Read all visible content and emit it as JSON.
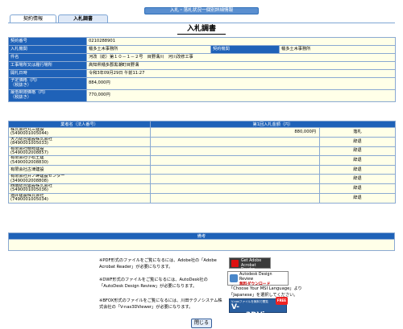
{
  "header": {
    "title": "入札・落札状況一個別詳細情報"
  },
  "tabs": [
    {
      "label": "契約情報"
    },
    {
      "label": "入札調書"
    }
  ],
  "page_title": "入札調書",
  "info": {
    "contract_no_label": "契約番号",
    "contract_no": "0210288901",
    "bid_agency_label": "入札機関",
    "bid_agency": "幡多土木事務所",
    "contract_agency_label": "契約機関",
    "contract_agency": "幡多土木事務所",
    "item_label": "件名",
    "item": "河改（総）第１０－１－２号　目野溝川　河川改修工事",
    "location_label": "工事場所又は履行場所",
    "location": "高知県幡多郡黒潮町目野溝",
    "date_label": "開札日時",
    "date": "令和3年09月29日 午前11:27",
    "planned_label": "予定価格（円）",
    "planned_sub": "（税抜き）",
    "planned": "884,000円",
    "min_label": "最低制限価格（円）",
    "min_sub": "（税抜き）",
    "min": "770,000円"
  },
  "bids": {
    "col_name": "業者名（法人番号）",
    "col_amount": "第1回入札金額（円）",
    "rows": [
      {
        "name": "株式会社丸三建設",
        "corp": "(5490001005044)",
        "amount": "880,000円",
        "result": "落札"
      },
      {
        "name": "大方総合建設株式会社",
        "corp": "(8490001005033)",
        "amount": "",
        "result": "辞退"
      },
      {
        "name": "有限会社穂岐建設",
        "corp": "(5490002008857)",
        "amount": "",
        "result": "辞退"
      },
      {
        "name": "有限会社小松土建",
        "corp": "(5490002008830)",
        "amount": "",
        "result": "辞退"
      },
      {
        "name": "有限会社古津建設",
        "corp": "",
        "amount": "",
        "result": "辞退"
      },
      {
        "name": "有限会社井ノ岬建設センター",
        "corp": "(3490002008808)",
        "amount": "",
        "result": "辞退"
      },
      {
        "name": "西南総合建設株式会社",
        "corp": "(5490001005036)",
        "amount": "",
        "result": "辞退"
      },
      {
        "name": "酒井建設株式会社",
        "corp": "(7490001005034)",
        "amount": "",
        "result": "辞退"
      }
    ]
  },
  "remarks": {
    "label": "備考",
    "text": ""
  },
  "notes": {
    "pdf": "※PDF形式のファイルをご覧になるには、Adobe社の「Adobe Acrobat Reader」が必要になります。",
    "dwf": "※DWF形式のファイルをご覧になるには、AutoDesk社の「AutoDesk Design Review」が必要になります。",
    "sfc": "※BFOX形式のファイルをご覧になるには、川田テクノシステム株式会社の「V-nas3DViewer」が必要になります。",
    "msi": "「Choose Your MSI Language」より「Japanese」を選択してください。"
  },
  "badges": {
    "acrobat_line1": "Get Adobe",
    "acrobat_line2": "Acrobat Reader",
    "dwr_line1": "Autodesk Design Review",
    "dwr_line2": "無料ダウンロード",
    "vnas_small": "V-nasファイルを無料で閲覧",
    "vnas_name": "V-nas3DViewer",
    "vnas_dl": "ダウンロードはこちら",
    "vnas_free": "FREE"
  },
  "close_label": "閉じる",
  "colors": {
    "header_blue": "#1f62b8",
    "cell_yellow": "#ffffe8",
    "tab_blue": "#5a8fd0"
  }
}
